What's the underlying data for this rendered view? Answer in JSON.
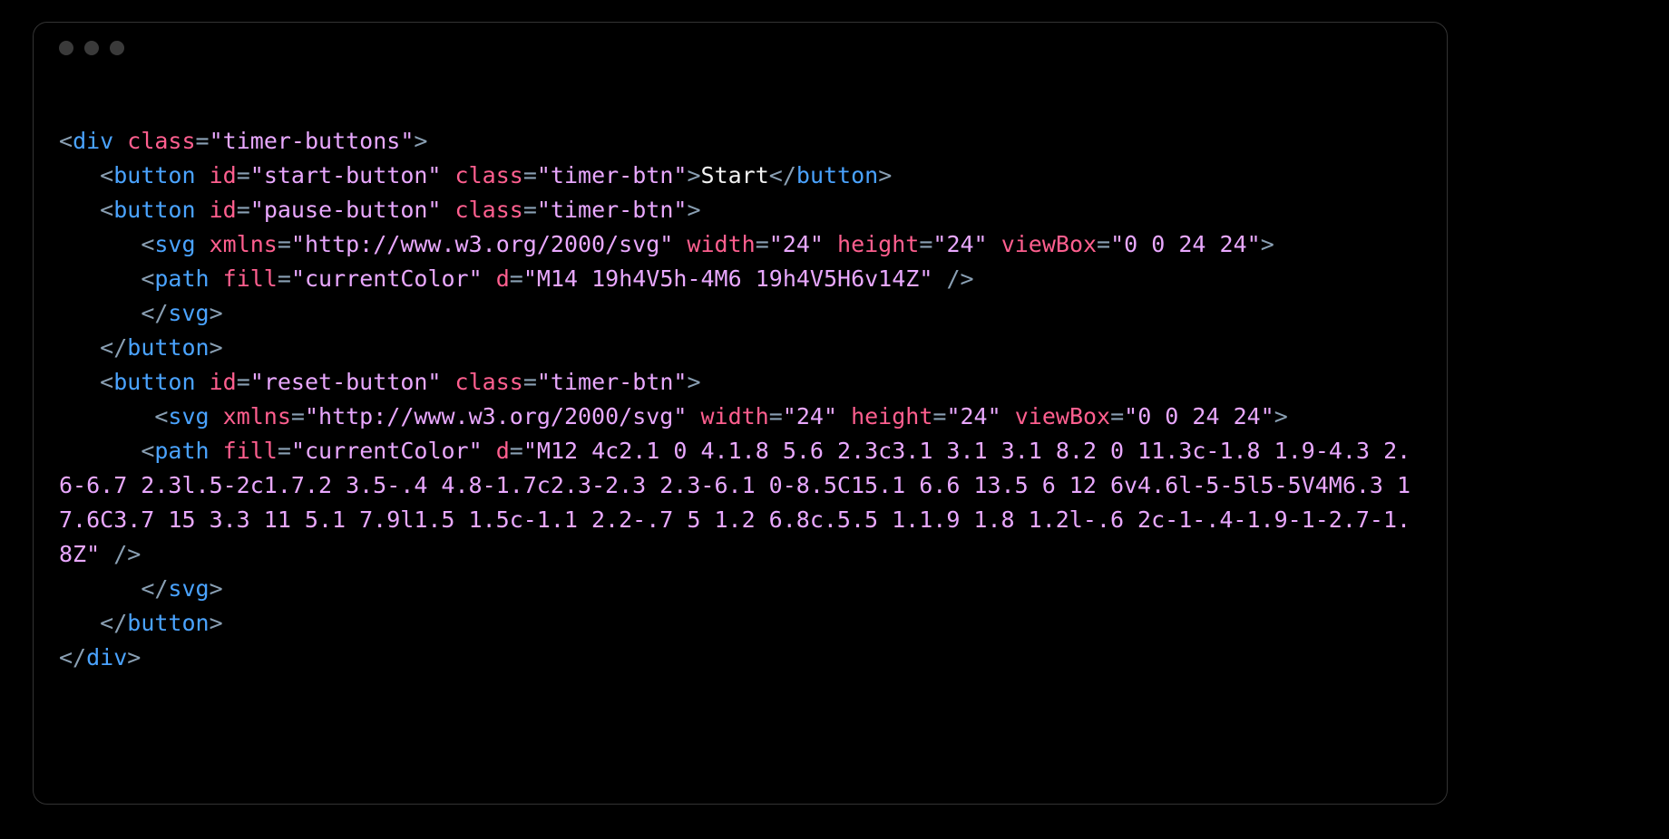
{
  "code": {
    "indent": "   ",
    "lines": [
      {
        "i": 0,
        "tokens": [
          {
            "k": "punc",
            "v": "<"
          },
          {
            "k": "tag",
            "v": "div"
          },
          {
            "k": "punc",
            "v": " "
          },
          {
            "k": "attr",
            "v": "class"
          },
          {
            "k": "punc",
            "v": "="
          },
          {
            "k": "str",
            "v": "\"timer-buttons\""
          },
          {
            "k": "punc",
            "v": ">"
          }
        ]
      },
      {
        "i": 1,
        "tokens": [
          {
            "k": "punc",
            "v": "<"
          },
          {
            "k": "tag",
            "v": "button"
          },
          {
            "k": "punc",
            "v": " "
          },
          {
            "k": "attr",
            "v": "id"
          },
          {
            "k": "punc",
            "v": "="
          },
          {
            "k": "str",
            "v": "\"start-button\""
          },
          {
            "k": "punc",
            "v": " "
          },
          {
            "k": "attr",
            "v": "class"
          },
          {
            "k": "punc",
            "v": "="
          },
          {
            "k": "str",
            "v": "\"timer-btn\""
          },
          {
            "k": "punc",
            "v": ">"
          },
          {
            "k": "text",
            "v": "Start"
          },
          {
            "k": "punc",
            "v": "</"
          },
          {
            "k": "tag",
            "v": "button"
          },
          {
            "k": "punc",
            "v": ">"
          }
        ]
      },
      {
        "i": 1,
        "tokens": [
          {
            "k": "punc",
            "v": "<"
          },
          {
            "k": "tag",
            "v": "button"
          },
          {
            "k": "punc",
            "v": " "
          },
          {
            "k": "attr",
            "v": "id"
          },
          {
            "k": "punc",
            "v": "="
          },
          {
            "k": "str",
            "v": "\"pause-button\""
          },
          {
            "k": "punc",
            "v": " "
          },
          {
            "k": "attr",
            "v": "class"
          },
          {
            "k": "punc",
            "v": "="
          },
          {
            "k": "str",
            "v": "\"timer-btn\""
          },
          {
            "k": "punc",
            "v": ">"
          }
        ]
      },
      {
        "i": 2,
        "tokens": [
          {
            "k": "punc",
            "v": "<"
          },
          {
            "k": "tag",
            "v": "svg"
          },
          {
            "k": "punc",
            "v": " "
          },
          {
            "k": "attr",
            "v": "xmlns"
          },
          {
            "k": "punc",
            "v": "="
          },
          {
            "k": "str",
            "v": "\"http://www.w3.org/2000/svg\""
          },
          {
            "k": "punc",
            "v": " "
          },
          {
            "k": "attr",
            "v": "width"
          },
          {
            "k": "punc",
            "v": "="
          },
          {
            "k": "str",
            "v": "\"24\""
          },
          {
            "k": "punc",
            "v": " "
          },
          {
            "k": "attr",
            "v": "height"
          },
          {
            "k": "punc",
            "v": "="
          },
          {
            "k": "str",
            "v": "\"24\""
          },
          {
            "k": "punc",
            "v": " "
          },
          {
            "k": "attr",
            "v": "viewBox"
          },
          {
            "k": "punc",
            "v": "="
          },
          {
            "k": "str",
            "v": "\"0 0 24 24\""
          },
          {
            "k": "punc",
            "v": ">"
          }
        ]
      },
      {
        "i": 2,
        "tokens": [
          {
            "k": "punc",
            "v": "<"
          },
          {
            "k": "tag",
            "v": "path"
          },
          {
            "k": "punc",
            "v": " "
          },
          {
            "k": "attr",
            "v": "fill"
          },
          {
            "k": "punc",
            "v": "="
          },
          {
            "k": "str",
            "v": "\"currentColor\""
          },
          {
            "k": "punc",
            "v": " "
          },
          {
            "k": "attr",
            "v": "d"
          },
          {
            "k": "punc",
            "v": "="
          },
          {
            "k": "str",
            "v": "\"M14 19h4V5h-4M6 19h4V5H6v14Z\""
          },
          {
            "k": "punc",
            "v": " />"
          }
        ]
      },
      {
        "i": 2,
        "tokens": [
          {
            "k": "punc",
            "v": "</"
          },
          {
            "k": "tag",
            "v": "svg"
          },
          {
            "k": "punc",
            "v": ">"
          }
        ]
      },
      {
        "i": 1,
        "tokens": [
          {
            "k": "punc",
            "v": "</"
          },
          {
            "k": "tag",
            "v": "button"
          },
          {
            "k": "punc",
            "v": ">"
          }
        ]
      },
      {
        "i": 1,
        "tokens": [
          {
            "k": "punc",
            "v": "<"
          },
          {
            "k": "tag",
            "v": "button"
          },
          {
            "k": "punc",
            "v": " "
          },
          {
            "k": "attr",
            "v": "id"
          },
          {
            "k": "punc",
            "v": "="
          },
          {
            "k": "str",
            "v": "\"reset-button\""
          },
          {
            "k": "punc",
            "v": " "
          },
          {
            "k": "attr",
            "v": "class"
          },
          {
            "k": "punc",
            "v": "="
          },
          {
            "k": "str",
            "v": "\"timer-btn\""
          },
          {
            "k": "punc",
            "v": ">"
          }
        ]
      },
      {
        "i": 2,
        "tokens": [
          {
            "k": "punc",
            "v": " <"
          },
          {
            "k": "tag",
            "v": "svg"
          },
          {
            "k": "punc",
            "v": " "
          },
          {
            "k": "attr",
            "v": "xmlns"
          },
          {
            "k": "punc",
            "v": "="
          },
          {
            "k": "str",
            "v": "\"http://www.w3.org/2000/svg\""
          },
          {
            "k": "punc",
            "v": " "
          },
          {
            "k": "attr",
            "v": "width"
          },
          {
            "k": "punc",
            "v": "="
          },
          {
            "k": "str",
            "v": "\"24\""
          },
          {
            "k": "punc",
            "v": " "
          },
          {
            "k": "attr",
            "v": "height"
          },
          {
            "k": "punc",
            "v": "="
          },
          {
            "k": "str",
            "v": "\"24\""
          },
          {
            "k": "punc",
            "v": " "
          },
          {
            "k": "attr",
            "v": "viewBox"
          },
          {
            "k": "punc",
            "v": "="
          },
          {
            "k": "str",
            "v": "\"0 0 24 24\""
          },
          {
            "k": "punc",
            "v": ">"
          }
        ]
      },
      {
        "i": 2,
        "tokens": [
          {
            "k": "punc",
            "v": "<"
          },
          {
            "k": "tag",
            "v": "path"
          },
          {
            "k": "punc",
            "v": " "
          },
          {
            "k": "attr",
            "v": "fill"
          },
          {
            "k": "punc",
            "v": "="
          },
          {
            "k": "str",
            "v": "\"currentColor\""
          },
          {
            "k": "punc",
            "v": " "
          },
          {
            "k": "attr",
            "v": "d"
          },
          {
            "k": "punc",
            "v": "="
          },
          {
            "k": "str",
            "v": "\"M12 4c2.1 0 4.1.8 5.6 2.3c3.1 3.1 3.1 8.2 0 11.3c-1.8 1.9-4.3 2.6-6.7 2.3l.5-2c1.7.2 3.5-.4 4.8-1.7c2.3-2.3 2.3-6.1 0-8.5C15.1 6.6 13.5 6 12 6v4.6l-5-5l5-5V4M6.3 17.6C3.7 15 3.3 11 5.1 7.9l1.5 1.5c-1.1 2.2-.7 5 1.2 6.8c.5.5 1.1.9 1.8 1.2l-.6 2c-1-.4-1.9-1-2.7-1.8Z\""
          },
          {
            "k": "punc",
            "v": " />"
          }
        ]
      },
      {
        "i": 2,
        "tokens": [
          {
            "k": "punc",
            "v": "</"
          },
          {
            "k": "tag",
            "v": "svg"
          },
          {
            "k": "punc",
            "v": ">"
          }
        ]
      },
      {
        "i": 1,
        "tokens": [
          {
            "k": "punc",
            "v": "</"
          },
          {
            "k": "tag",
            "v": "button"
          },
          {
            "k": "punc",
            "v": ">"
          }
        ]
      },
      {
        "i": 0,
        "tokens": [
          {
            "k": "punc",
            "v": "</"
          },
          {
            "k": "tag",
            "v": "div"
          },
          {
            "k": "punc",
            "v": ">"
          }
        ]
      }
    ]
  }
}
